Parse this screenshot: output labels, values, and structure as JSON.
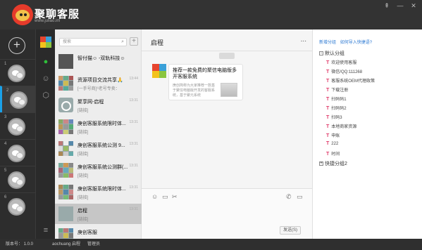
{
  "app": {
    "name": "聚聊客服",
    "url": "www.juliao.im"
  },
  "window_controls": {
    "pin": "⇞",
    "minimize": "—",
    "close": "✕"
  },
  "accounts": [
    {
      "num": "1"
    },
    {
      "num": "2"
    },
    {
      "num": "3"
    },
    {
      "num": "4"
    },
    {
      "num": "5"
    },
    {
      "num": "6"
    }
  ],
  "search": {
    "placeholder": "搜索"
  },
  "chats": [
    {
      "name": "智付猫☺ -双轨科技☺",
      "sub": "",
      "time": ""
    },
    {
      "name": "资源项目交流共享🙏",
      "sub": "[一手号商]⁶老号专卖：",
      "time": "13:44"
    },
    {
      "name": "聚享网-启程",
      "sub": "[链接]",
      "time": "13:31"
    },
    {
      "name": "庚创客服系统限时体...",
      "sub": "[链接]",
      "time": "13:31"
    },
    {
      "name": "庚创客服系统公测 9...",
      "sub": "[链接]",
      "time": "13:31"
    },
    {
      "name": "庚创客服系统公测群(...",
      "sub": "[链接]",
      "time": "13:31"
    },
    {
      "name": "庚创客服系统限时体...",
      "sub": "[链接]",
      "time": "13:31"
    },
    {
      "name": "启程",
      "sub": "[链接]",
      "time": "13:31"
    },
    {
      "name": "庚创客服",
      "sub": "",
      "time": ""
    }
  ],
  "conversation": {
    "title": "启程",
    "more": "...",
    "card_title": "推荐一款免费的聚信电脑版多开客服系统",
    "card_desc": "庚创简称为大家推荐一款基于聚信电脑版开发的客服系统，基于聚元系统",
    "send_label": "发送(S)"
  },
  "right_panel": {
    "link1": "新增分组",
    "link2": "如何导入快捷语?",
    "group1": "默认分组",
    "group2": "快捷分组2",
    "items": [
      "欢迎使用客服",
      "微信/QQ:111268",
      "客服系统OEM代理政策",
      "下载注册",
      "扫码码1",
      "扫码码2",
      "扫码3",
      "本地商家资源",
      "申账",
      "222",
      "时间"
    ]
  },
  "status": {
    "version_label": "版本号： 1.0.0",
    "user": "aochuang 启程",
    "admin": "管理员"
  }
}
